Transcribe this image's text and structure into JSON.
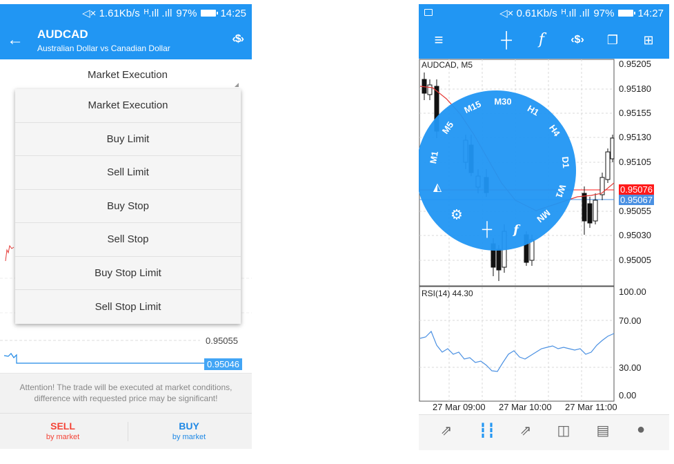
{
  "left": {
    "status": {
      "net_speed": "1.61Kb/s",
      "battery": "97%",
      "time": "14:25"
    },
    "header": {
      "symbol": "AUDCAD",
      "description": "Australian Dollar vs Canadian Dollar"
    },
    "execution_select": {
      "selected": "Market Execution"
    },
    "order_types": [
      "Market Execution",
      "Buy Limit",
      "Sell Limit",
      "Buy Stop",
      "Sell Stop",
      "Buy Stop Limit",
      "Sell Stop Limit"
    ],
    "prices": {
      "upper": "0.95055",
      "current": "0.95046"
    },
    "attention_line1": "Attention! The trade will be executed at market conditions,",
    "attention_line2": "difference with requested price may be significant!",
    "sell": {
      "label": "SELL",
      "sub": "by market"
    },
    "buy": {
      "label": "BUY",
      "sub": "by market"
    }
  },
  "right": {
    "status": {
      "net_speed": "0.61Kb/s",
      "battery": "97%",
      "time": "14:27"
    },
    "chart_title": "AUDCAD, M5",
    "rsi_title": "RSI(14) 44.30",
    "timeframes": [
      "M1",
      "M5",
      "M15",
      "M30",
      "H1",
      "H4",
      "D1",
      "W1",
      "MN"
    ],
    "price_axis": [
      "0.95205",
      "0.95180",
      "0.95155",
      "0.95130",
      "0.95105",
      "0.95055",
      "0.95030",
      "0.95005"
    ],
    "bid_price": "0.95076",
    "ask_price": "0.95067",
    "rsi_axis": [
      "100.00",
      "70.00",
      "30.00",
      "0.00"
    ],
    "time_axis": [
      "27 Mar 09:00",
      "27 Mar 10:00",
      "27 Mar 11:00"
    ]
  },
  "colors": {
    "primary": "#2196f3",
    "sell": "#f44336",
    "buy": "#1e88e5",
    "bid": "#ff1a1a",
    "ask": "#4a90e2"
  }
}
